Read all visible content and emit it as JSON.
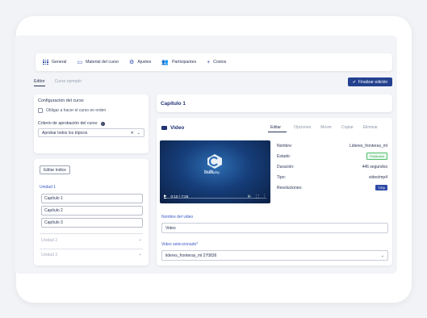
{
  "nav": {
    "items": [
      {
        "icon": "grid-icon",
        "label": "General"
      },
      {
        "icon": "book-icon",
        "label": "Material del curso"
      },
      {
        "icon": "gear-icon",
        "label": "Ajustes"
      },
      {
        "icon": "users-icon",
        "label": "Participantes"
      },
      {
        "icon": "plus-icon",
        "label": "Costos"
      }
    ]
  },
  "subtabs": {
    "editor": "Editor",
    "example": "Curso ejemplo"
  },
  "finalize_label": "Finalizar edición",
  "config": {
    "title": "Configuración del curso",
    "order_label": "Obligar a hacer el curso en orden",
    "criterion_label": "Criterio de aprobación del curso",
    "criterion_value": "Aprobar todos los tópicos"
  },
  "index": {
    "edit_label": "Editar índice",
    "unit1": "Unidad 1",
    "chapters": [
      "Capítulo 1",
      "Capítulo 2",
      "Capítulo 3"
    ],
    "unit2": "Unidad 2",
    "unit3": "Unidad 3"
  },
  "chapter_title": "Capítulo 1",
  "video": {
    "title": "Video",
    "tabs": [
      "Editar",
      "Opciones",
      "Mover",
      "Copiar",
      "Eliminar"
    ],
    "player": {
      "brand": "bulk",
      "brand_suffix": "play",
      "time": "0:10 / 7:26",
      "progress": 0.02
    },
    "meta": {
      "name_label": "Nombre:",
      "name_value": "Lideres_fronteras_ml",
      "status_label": "Estado:",
      "status_value": "Publicado",
      "duration_label": "Duración:",
      "duration_value": "446 segundos",
      "type_label": "Tipo:",
      "type_value": "video/mp4",
      "res_label": "Resoluciones:",
      "res_value": "720p"
    },
    "name_field_label": "Nombre del video",
    "name_field_value": "Video",
    "selected_label": "Video seleccionado*",
    "selected_value": "lideres_fronteras_ml 270836"
  },
  "colors": {
    "accent": "#23418f",
    "link": "#3a5bc7",
    "success": "#3aa655"
  }
}
